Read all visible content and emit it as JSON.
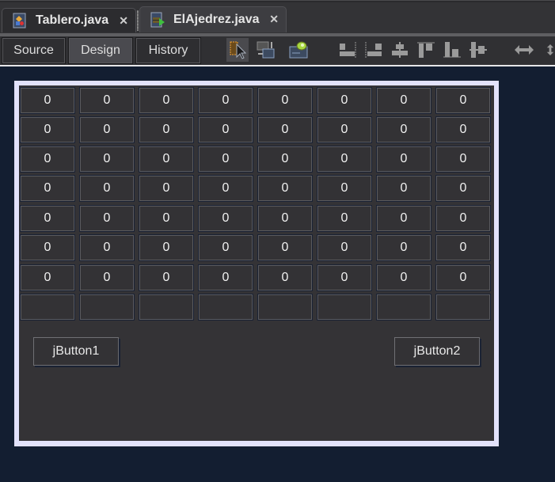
{
  "editor_tabs": [
    {
      "label": "Tablero.java",
      "icon": "form-file-icon",
      "active": false
    },
    {
      "label": "ElAjedrez.java",
      "icon": "runnable-java-file-icon",
      "active": true
    }
  ],
  "view_buttons": [
    {
      "label": "Source",
      "active": false
    },
    {
      "label": "Design",
      "active": true
    },
    {
      "label": "History",
      "active": false
    }
  ],
  "toolbar_tools": [
    "selection-mode-icon",
    "connection-mode-icon",
    "preview-design-icon",
    "align-left-icon",
    "align-right-icon",
    "center-horizontally-icon",
    "align-top-icon",
    "align-bottom-icon",
    "center-vertically-icon",
    "resize-horizontal-icon",
    "resize-vertical-icon"
  ],
  "board": {
    "rows": [
      [
        "0",
        "0",
        "0",
        "0",
        "0",
        "0",
        "0",
        "0"
      ],
      [
        "0",
        "0",
        "0",
        "0",
        "0",
        "0",
        "0",
        "0"
      ],
      [
        "0",
        "0",
        "0",
        "0",
        "0",
        "0",
        "0",
        "0"
      ],
      [
        "0",
        "0",
        "0",
        "0",
        "0",
        "0",
        "0",
        "0"
      ],
      [
        "0",
        "0",
        "0",
        "0",
        "0",
        "0",
        "0",
        "0"
      ],
      [
        "0",
        "0",
        "0",
        "0",
        "0",
        "0",
        "0",
        "0"
      ],
      [
        "0",
        "0",
        "0",
        "0",
        "0",
        "0",
        "0",
        "0"
      ],
      [
        "",
        "",
        "",
        "",
        "",
        "",
        "",
        ""
      ]
    ]
  },
  "buttons": {
    "button1": "jButton1",
    "button2": "jButton2"
  },
  "close_glyph": "✕"
}
